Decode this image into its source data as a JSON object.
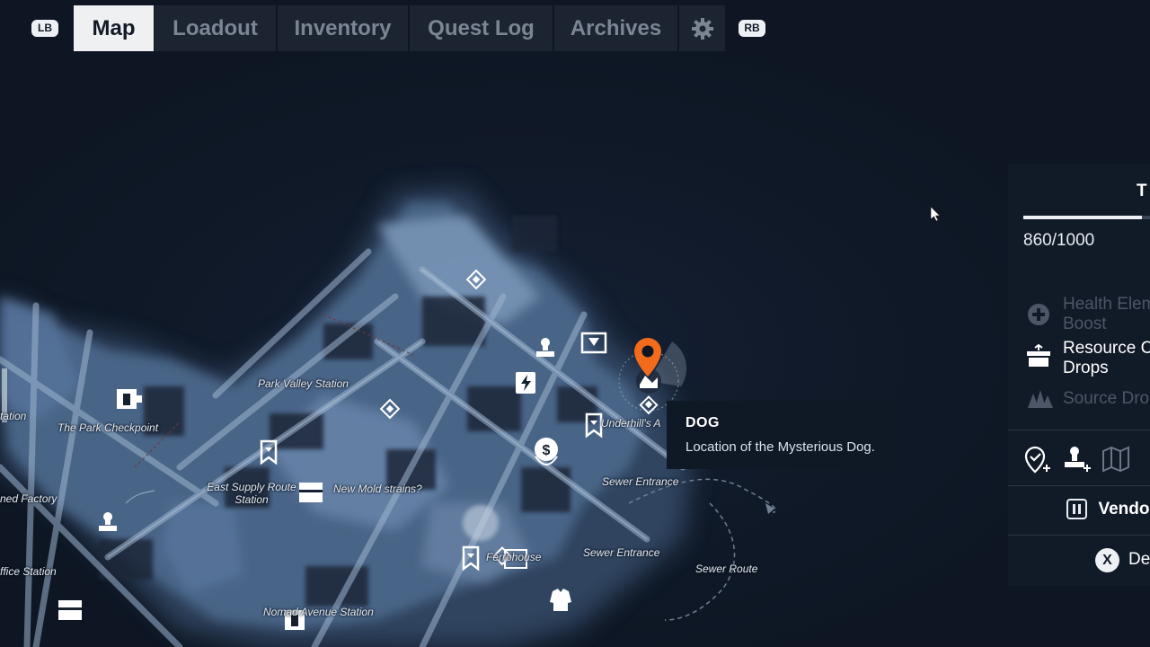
{
  "top_nav": {
    "left_bumper": "LB",
    "right_bumper": "RB",
    "tabs": [
      {
        "label": "Map",
        "active": true
      },
      {
        "label": "Loadout",
        "active": false
      },
      {
        "label": "Inventory",
        "active": false
      },
      {
        "label": "Quest Log",
        "active": false
      },
      {
        "label": "Archives",
        "active": false
      }
    ],
    "settings_icon": "gear-icon"
  },
  "map": {
    "locations": {
      "park_valley_station": "Park Valley Station",
      "park_checkpoint": "The Park Checkpoint",
      "station_partial": "tation",
      "factory_partial": "ned Factory",
      "east_supply_route_1": "East Supply Route",
      "east_supply_route_2": "Station",
      "new_mold_strains": "New Mold strains?",
      "sewer_entrance_1": "Sewer Entrance",
      "sewer_entrance_2": "Sewer Entrance",
      "sewer_route": "Sewer Route",
      "underhills": "Underhill's A",
      "ferrohouse": "Ferrohouse",
      "office_station": "ffice Station",
      "nomad_avenue": "Nomad Avenue Station"
    },
    "selected_marker_color": "#f26a1b",
    "accent_colors": {
      "marker": "#f26a1b",
      "panel_bg": "#111a27"
    }
  },
  "tooltip": {
    "title": "DOG",
    "description": "Location of the Mysterious Dog."
  },
  "side_panel": {
    "title_partial": "T",
    "progress_text": "860/1000",
    "progress_fraction": 0.86,
    "rewards": [
      {
        "icon": "plus-circle-icon",
        "line1": "Health Elem",
        "line2": "Boost",
        "dimmed": true
      },
      {
        "icon": "crate-icon",
        "line1": "Resource C",
        "line2": "Drops",
        "dimmed": false
      },
      {
        "icon": "source-drops-icon",
        "line1": "Source Dro",
        "line2": "",
        "dimmed": true
      }
    ],
    "action_icons": [
      "add-waypoint-icon",
      "add-marker-icon",
      "map-icon"
    ],
    "vendor_key_label": "Vendo",
    "x_button": "X",
    "x_action_label": "De"
  }
}
